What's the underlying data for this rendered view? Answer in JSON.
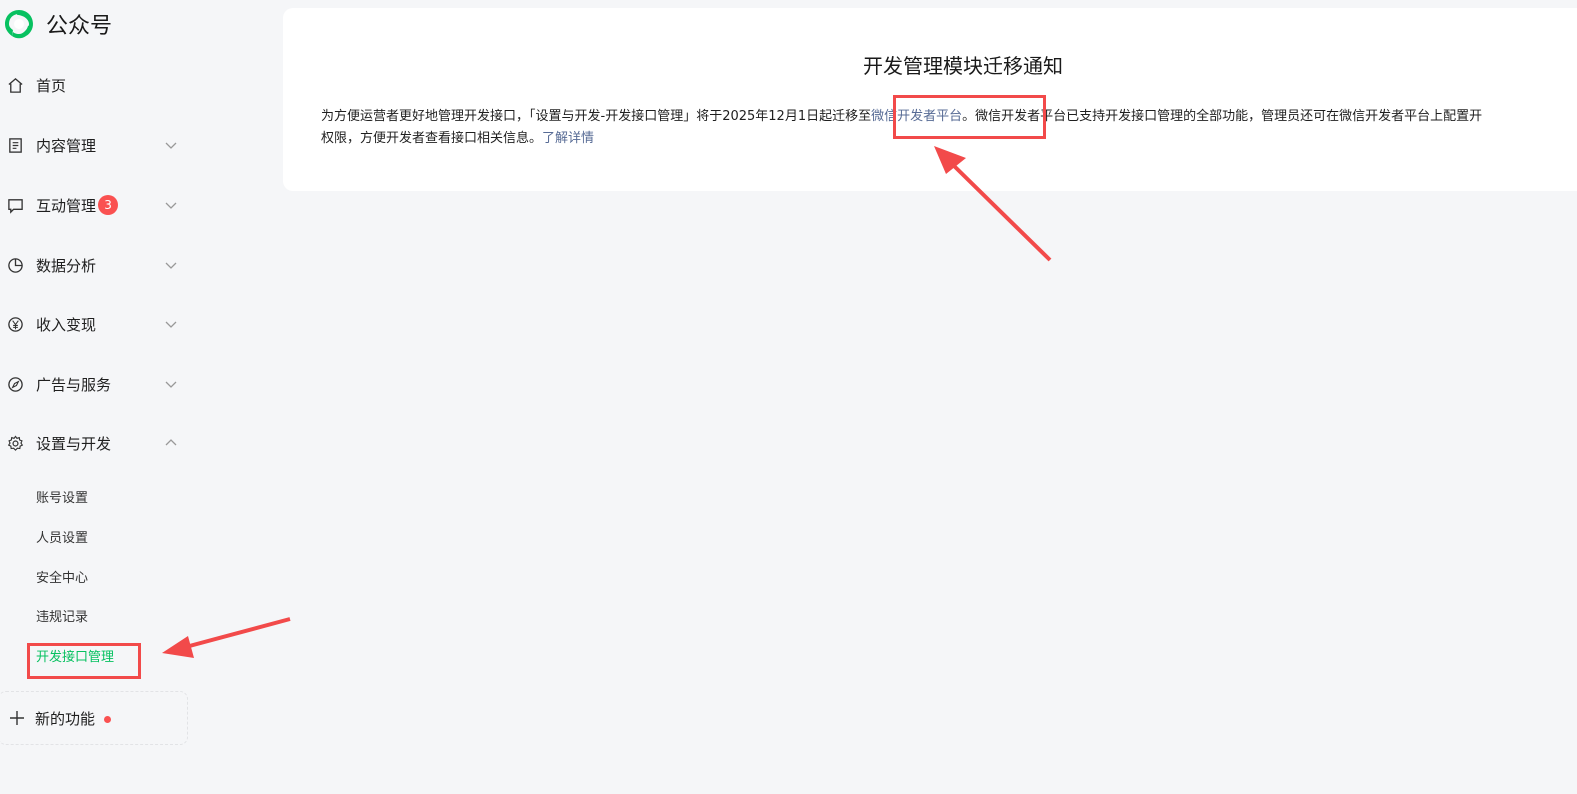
{
  "brand": {
    "name": "公众号"
  },
  "nav": {
    "items": [
      {
        "label": "首页",
        "icon": "home-icon"
      },
      {
        "label": "内容管理",
        "icon": "document-icon"
      },
      {
        "label": "互动管理",
        "icon": "message-icon",
        "badge": "3"
      },
      {
        "label": "数据分析",
        "icon": "pie-chart-icon"
      },
      {
        "label": "收入变现",
        "icon": "yen-icon"
      },
      {
        "label": "广告与服务",
        "icon": "compass-icon"
      },
      {
        "label": "设置与开发",
        "icon": "gear-icon"
      }
    ],
    "sub_items": [
      "账号设置",
      "人员设置",
      "安全中心",
      "违规记录",
      "开发接口管理"
    ],
    "new_function": "新的功能"
  },
  "notice": {
    "title": "开发管理模块迁移通知",
    "text_part1": "为方便运营者更好地管理开发接口，「设置与开发-开发接口管理」将于2025年12月1日起迁移至",
    "link_platform": "微信开发者平台",
    "text_part2": "。微信开发者平台已支持开发接口管理的全部功能，管理员还可在微信开发者平台上配置开",
    "text_part3": "权限，方便开发者查看接口相关信息。",
    "link_details": "了解详情"
  },
  "colors": {
    "accent": "#07c160",
    "badge": "#fa5151",
    "link": "#576b95",
    "annotation": "#f24a4a"
  }
}
